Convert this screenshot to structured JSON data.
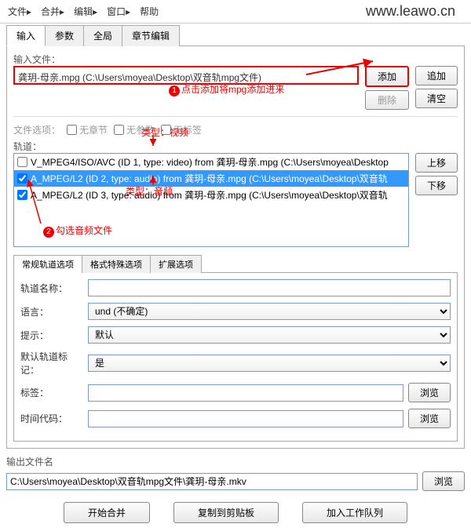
{
  "menu": {
    "file": "文件▸",
    "merge": "合并▸",
    "edit": "编辑▸",
    "window": "窗口▸",
    "help": "帮助"
  },
  "watermark": "www.leawo.cn",
  "maintabs": {
    "input": "输入",
    "params": "参数",
    "global": "全局",
    "chapter": "章节编辑"
  },
  "inputFileLabel": "输入文件：",
  "inputFile": "龚玥-母亲.mpg (C:\\Users\\moyea\\Desktop\\双音轨mpg文件)",
  "btns": {
    "add": "添加",
    "append": "追加",
    "delete": "删除",
    "clear": "清空",
    "up": "上移",
    "down": "下移",
    "browse": "浏览",
    "start": "开始合并",
    "copy": "复制到剪贴板",
    "queue": "加入工作队列"
  },
  "fileOptionsLabel": "文件选项：",
  "fileOptions": {
    "noChapter": "无章节",
    "noParams": "无参数",
    "noTags": "无标签"
  },
  "tracksLabel": "轨道：",
  "tracks": [
    {
      "checked": false,
      "text": "V_MPEG4/ISO/AVC (ID 1, type: video) from 龚玥-母亲.mpg (C:\\Users\\moyea\\Desktop"
    },
    {
      "checked": true,
      "text": "A_MPEG/L2 (ID 2, type: audio) from 龚玥-母亲.mpg (C:\\Users\\moyea\\Desktop\\双音轨",
      "selected": true
    },
    {
      "checked": true,
      "text": "A_MPEG/L2 (ID 3, type: audio) from 龚玥-母亲.mpg (C:\\Users\\moyea\\Desktop\\双音轨"
    }
  ],
  "subtabs": {
    "regular": "常规轨道选项",
    "format": "格式特殊选项",
    "ext": "扩展选项"
  },
  "form": {
    "trackName": "轨道名称：",
    "lang": "语言：",
    "langVal": "und (不确定)",
    "hint": "提示：",
    "hintVal": "默认",
    "defTrack": "默认轨道标记：",
    "defVal": "是",
    "tag": "标签：",
    "timecode": "时间代码："
  },
  "outLabel": "输出文件名",
  "outPath": "C:\\Users\\moyea\\Desktop\\双音轨mpg文件\\龚玥-母亲.mkv",
  "annotations": {
    "typeVideo": "类型：视频",
    "typeAudio": "类型：音频",
    "step1": "点击添加将mpg添加进来",
    "step2": "勾选音频文件"
  }
}
